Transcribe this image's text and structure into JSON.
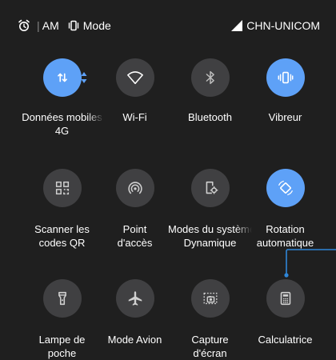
{
  "status": {
    "time": "AM",
    "mode_text": "Mode",
    "carrier": "CHN-UNICOM"
  },
  "tiles": [
    {
      "label": "Données mobiles",
      "sub": "4G",
      "icon": "mobile-data-icon",
      "active": true
    },
    {
      "label": "Wi-Fi",
      "icon": "wifi-icon",
      "active": false
    },
    {
      "label": "Bluetooth",
      "icon": "bluetooth-icon",
      "active": false
    },
    {
      "label": "Vibreur",
      "icon": "vibrate-icon",
      "active": true
    },
    {
      "label": "Scanner les\ncodes QR",
      "icon": "qr-scanner-icon",
      "active": false
    },
    {
      "label": "Point\nd'accès",
      "icon": "hotspot-icon",
      "active": false
    },
    {
      "label": "Modes du système",
      "sub": "Dynamique",
      "icon": "system-modes-icon",
      "active": false
    },
    {
      "label": "Rotation\nautomatique",
      "icon": "auto-rotate-icon",
      "active": true
    },
    {
      "label": "Lampe de\npoche",
      "icon": "flashlight-icon",
      "active": false
    },
    {
      "label": "Mode Avion",
      "icon": "airplane-icon",
      "active": false
    },
    {
      "label": "Capture\nd'écran",
      "icon": "screenshot-icon",
      "active": false
    },
    {
      "label": "Calculatrice",
      "icon": "calculator-icon",
      "active": false
    }
  ],
  "colors": {
    "background": "#1f1f1f",
    "tile_off": "#404042",
    "tile_on": "#5ea1f7",
    "callout_line": "#2f86d8"
  }
}
